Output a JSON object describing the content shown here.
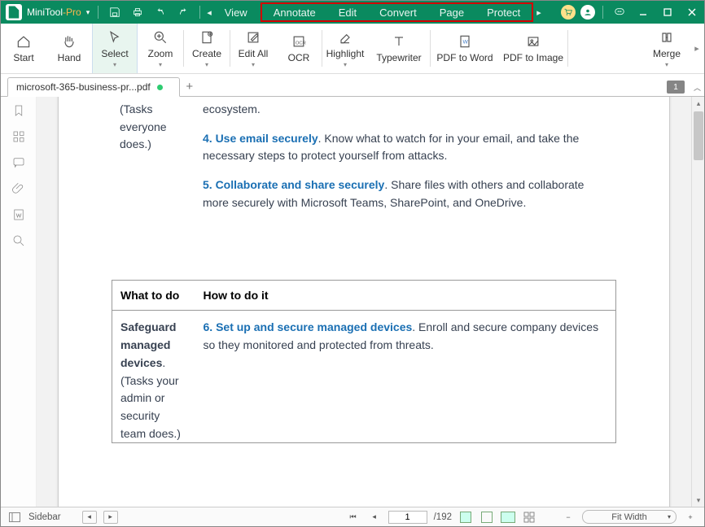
{
  "app": {
    "name1": "MiniTool",
    "name2": "-Pro"
  },
  "menus": {
    "scroll_item": "View",
    "items": [
      "Annotate",
      "Edit",
      "Convert",
      "Page",
      "Protect"
    ]
  },
  "ribbon": {
    "start": "Start",
    "hand": "Hand",
    "select": "Select",
    "zoom": "Zoom",
    "create": "Create",
    "edit_all": "Edit All",
    "ocr": "OCR",
    "highlight": "Highlight",
    "typewriter": "Typewriter",
    "pdf_to_word": "PDF to Word",
    "pdf_to_image": "PDF to Image",
    "merge": "Merge"
  },
  "tabs": {
    "file": "microsoft-365-business-pr...pdf",
    "page_badge": "1"
  },
  "doc": {
    "col_left_tasks": "(Tasks everyone does.)",
    "body_top_frag": "ecosystem.",
    "item4_title": "4. Use email securely",
    "item4_body": ". Know what to watch for in your email, and take the necessary steps to protect yourself from attacks.",
    "item5_title": "5. Collaborate and share securely",
    "item5_body": ". Share files with others and collaborate more securely with Microsoft Teams, SharePoint, and OneDrive.",
    "th1": "What to do",
    "th2": "How to do it",
    "row2_left_bold": "Safeguard managed devices",
    "row2_left_rest": ". (Tasks your admin or security team does.)",
    "item6_title": "6. Set up and secure managed devices",
    "item6_body": ". Enroll and secure company devices so they monitored and protected from threats."
  },
  "status": {
    "sidebar_label": "Sidebar",
    "page_current": "1",
    "page_total": "/192",
    "fit": "Fit Width"
  }
}
